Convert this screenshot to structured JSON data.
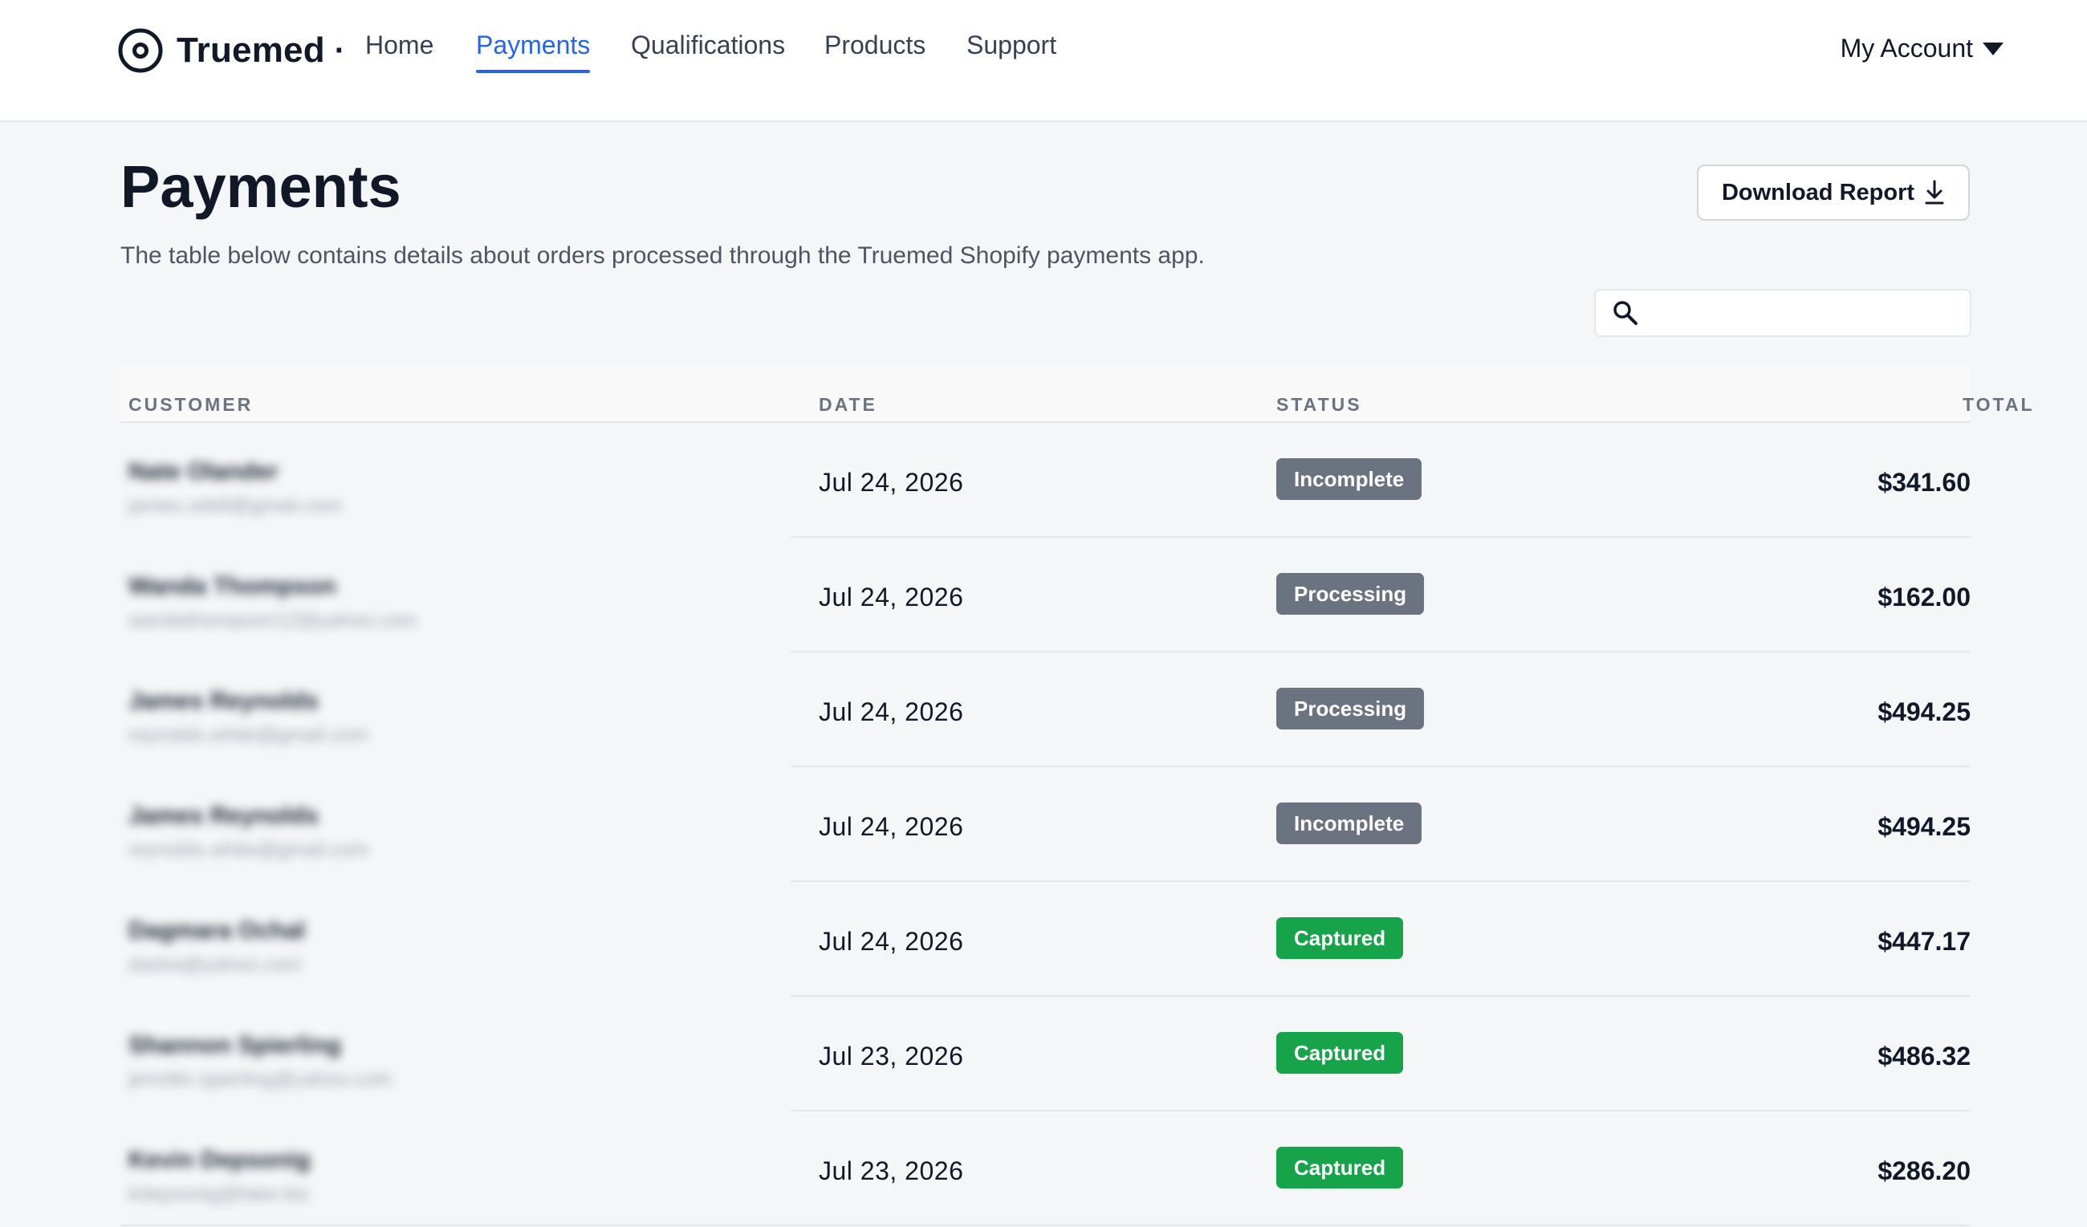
{
  "brand": {
    "name": "Truemed",
    "separator": "·"
  },
  "nav": {
    "items": [
      {
        "label": "Home",
        "active": false
      },
      {
        "label": "Payments",
        "active": true
      },
      {
        "label": "Qualifications",
        "active": false
      },
      {
        "label": "Products",
        "active": false
      },
      {
        "label": "Support",
        "active": false
      }
    ],
    "account_label": "My Account"
  },
  "page": {
    "title": "Payments",
    "subtitle": "The table below contains details about orders processed through the Truemed Shopify payments app.",
    "download_label": "Download Report"
  },
  "search": {
    "value": "",
    "placeholder": ""
  },
  "table": {
    "headers": {
      "customer": "CUSTOMER",
      "date": "DATE",
      "status": "STATUS",
      "total": "TOTAL"
    },
    "rows": [
      {
        "name": "Nate Olander",
        "email": "james.odell@gmail.com",
        "date": "Jul 24, 2026",
        "status": "Incomplete",
        "total": "$341.60"
      },
      {
        "name": "Wanda Thompson",
        "email": "wandathompson12@yahoo.com",
        "date": "Jul 24, 2026",
        "status": "Processing",
        "total": "$162.00"
      },
      {
        "name": "James Reynolds",
        "email": "reynolds.white@gmail.com",
        "date": "Jul 24, 2026",
        "status": "Processing",
        "total": "$494.25"
      },
      {
        "name": "James Reynolds",
        "email": "reynolds.white@gmail.com",
        "date": "Jul 24, 2026",
        "status": "Incomplete",
        "total": "$494.25"
      },
      {
        "name": "Dagmara Ochal",
        "email": "dasha@yahoo.com",
        "date": "Jul 24, 2026",
        "status": "Captured",
        "total": "$447.17"
      },
      {
        "name": "Shannon Spierling",
        "email": "jennifer.spierling@yahoo.com",
        "date": "Jul 23, 2026",
        "status": "Captured",
        "total": "$486.32"
      },
      {
        "name": "Kevin Depsonig",
        "email": "kdepsonig@fake.biz",
        "date": "Jul 23, 2026",
        "status": "Captured",
        "total": "$286.20"
      }
    ]
  },
  "colors": {
    "accent": "#2563eb",
    "status_incomplete": "#6b7280",
    "status_processing": "#6b7280",
    "status_captured": "#16a34a"
  }
}
